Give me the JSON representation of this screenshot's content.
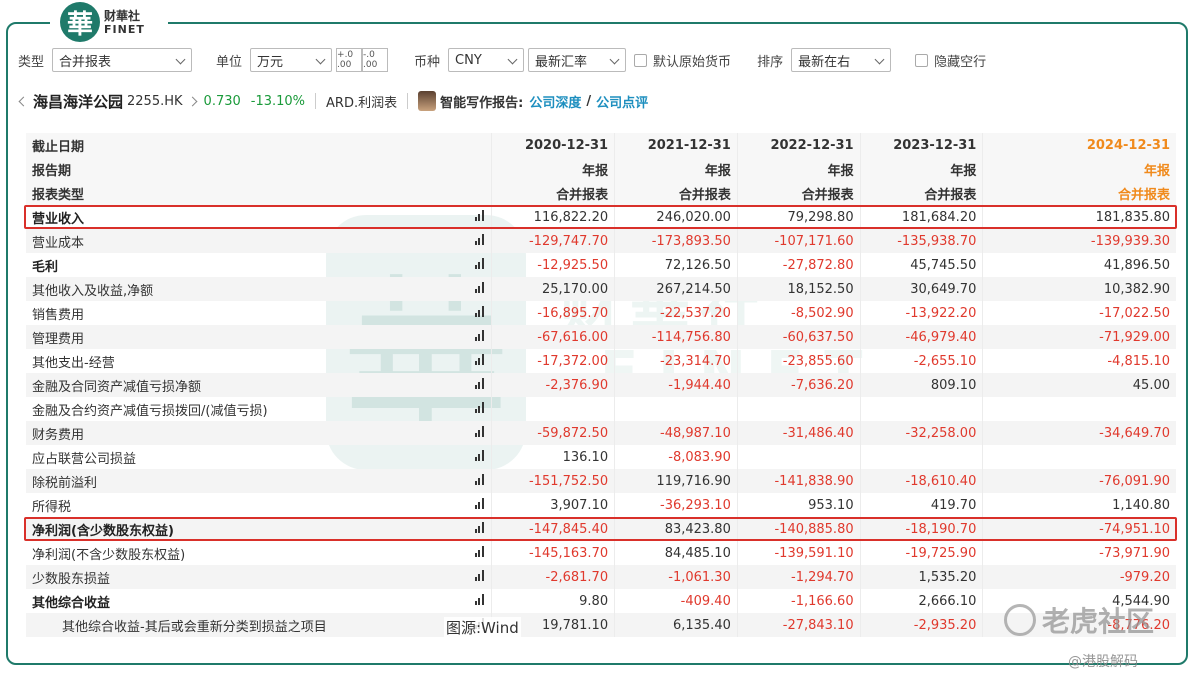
{
  "brand": {
    "logo_char": "華",
    "cn": "财華社",
    "en": "FINET"
  },
  "toolbar": {
    "type_label": "类型",
    "type_value": "合并报表",
    "unit_label": "单位",
    "unit_value": "万元",
    "decimal_inc": "+.0 .00",
    "decimal_dec": "-.0 .00",
    "currency_label": "币种",
    "currency_value": "CNY",
    "rate_value": "最新汇率",
    "orig_currency_label": "默认原始货币",
    "sort_label": "排序",
    "sort_value": "最新在右",
    "hide_empty_label": "隐藏空行"
  },
  "stock": {
    "name": "海昌海洋公园",
    "code": "2255.HK",
    "price": "0.730",
    "change": "-13.10%",
    "report_type": "ARD.利润表",
    "ai_label": "智能写作报告:",
    "link1": "公司深度",
    "link2": "公司点评"
  },
  "table": {
    "header_rows": [
      {
        "label": "截止日期",
        "values": [
          "2020-12-31",
          "2021-12-31",
          "2022-12-31",
          "2023-12-31",
          "2024-12-31"
        ]
      },
      {
        "label": "报告期",
        "values": [
          "年报",
          "年报",
          "年报",
          "年报",
          "年报"
        ]
      },
      {
        "label": "报表类型",
        "values": [
          "合并报表",
          "合并报表",
          "合并报表",
          "合并报表",
          "合并报表"
        ]
      }
    ],
    "rows": [
      {
        "label": "营业收入",
        "bold": true,
        "values": [
          "116,822.20",
          "246,020.00",
          "79,298.80",
          "181,684.20",
          "181,835.80"
        ]
      },
      {
        "label": "营业成本",
        "bold": false,
        "values": [
          "-129,747.70",
          "-173,893.50",
          "-107,171.60",
          "-135,938.70",
          "-139,939.30"
        ]
      },
      {
        "label": "毛利",
        "bold": true,
        "values": [
          "-12,925.50",
          "72,126.50",
          "-27,872.80",
          "45,745.50",
          "41,896.50"
        ]
      },
      {
        "label": "其他收入及收益,净额",
        "bold": false,
        "values": [
          "25,170.00",
          "267,214.50",
          "18,152.50",
          "30,649.70",
          "10,382.90"
        ]
      },
      {
        "label": "销售费用",
        "bold": false,
        "values": [
          "-16,895.70",
          "-22,537.20",
          "-8,502.90",
          "-13,922.20",
          "-17,022.50"
        ]
      },
      {
        "label": "管理费用",
        "bold": false,
        "values": [
          "-67,616.00",
          "-114,756.80",
          "-60,637.50",
          "-46,979.40",
          "-71,929.00"
        ]
      },
      {
        "label": "其他支出-经营",
        "bold": false,
        "values": [
          "-17,372.00",
          "-23,314.70",
          "-23,855.60",
          "-2,655.10",
          "-4,815.10"
        ]
      },
      {
        "label": "金融及合同资产减值亏损净额",
        "bold": false,
        "values": [
          "-2,376.90",
          "-1,944.40",
          "-7,636.20",
          "809.10",
          "45.00"
        ]
      },
      {
        "label": "金融及合约资产减值亏损拨回/(减值亏损)",
        "bold": false,
        "values": [
          "",
          "",
          "",
          "",
          ""
        ]
      },
      {
        "label": "财务费用",
        "bold": false,
        "values": [
          "-59,872.50",
          "-48,987.10",
          "-31,486.40",
          "-32,258.00",
          "-34,649.70"
        ]
      },
      {
        "label": "应占联营公司损益",
        "bold": false,
        "values": [
          "136.10",
          "-8,083.90",
          "",
          "",
          ""
        ]
      },
      {
        "label": "除税前溢利",
        "bold": false,
        "values": [
          "-151,752.50",
          "119,716.90",
          "-141,838.90",
          "-18,610.40",
          "-76,091.90"
        ]
      },
      {
        "label": "所得税",
        "bold": false,
        "values": [
          "3,907.10",
          "-36,293.10",
          "953.10",
          "419.70",
          "1,140.80"
        ]
      },
      {
        "label": "净利润(含少数股东权益)",
        "bold": true,
        "values": [
          "-147,845.40",
          "83,423.80",
          "-140,885.80",
          "-18,190.70",
          "-74,951.10"
        ]
      },
      {
        "label": "净利润(不含少数股东权益)",
        "bold": false,
        "values": [
          "-145,163.70",
          "84,485.10",
          "-139,591.10",
          "-19,725.90",
          "-73,971.90"
        ]
      },
      {
        "label": "少数股东损益",
        "bold": false,
        "values": [
          "-2,681.70",
          "-1,061.30",
          "-1,294.70",
          "1,535.20",
          "-979.20"
        ]
      },
      {
        "label": "其他综合收益",
        "bold": true,
        "values": [
          "9.80",
          "-409.40",
          "-1,166.60",
          "2,666.10",
          "4,544.90"
        ]
      },
      {
        "label": "其他综合收益-其后或会重新分类到损益之项目",
        "bold": false,
        "indent": true,
        "values": [
          "19,781.10",
          "6,135.40",
          "-27,843.10",
          "-2,935.20",
          "-8,776.20"
        ]
      }
    ]
  },
  "source_note": "图源:Wind",
  "watermarks": {
    "main_char": "華",
    "cn": "财華社",
    "en": "FINET",
    "tiger": "老虎社区",
    "credit": "@港股解码"
  }
}
